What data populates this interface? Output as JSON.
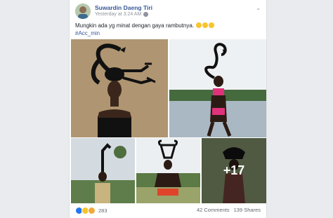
{
  "post": {
    "author": "Suwardin Daeng Tiri",
    "timestamp": "Yesterday at 3:24 AM",
    "text": "Mungkin ada yg minat dengan gaya rambutnya.",
    "hashtag": "#Acc_min",
    "more_photos": "+17"
  },
  "footer": {
    "reaction_count": "283",
    "comments": "42 Comments",
    "shares": "139 Shares"
  },
  "icons": [
    "globe-icon",
    "chevron-down-icon",
    "like-reaction-icon",
    "haha-reaction-icon",
    "wow-reaction-icon"
  ],
  "colors": {
    "link": "#385898",
    "page_bg": "#e9ebee",
    "like": "#2078f4"
  }
}
